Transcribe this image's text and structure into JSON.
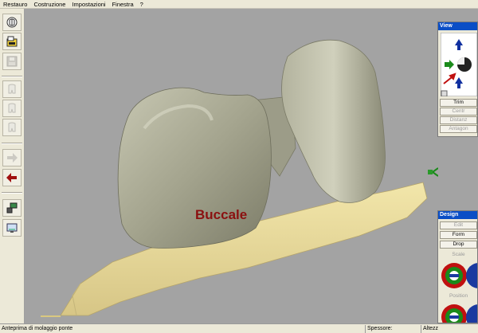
{
  "menu": [
    "Restauro",
    "Costruzione",
    "Impostazioni",
    "Finestra",
    "?"
  ],
  "toolbar": {
    "buttons": [
      {
        "name": "teeth-icon",
        "enabled": true
      },
      {
        "name": "open-folder-icon",
        "enabled": true
      },
      {
        "name": "save-icon",
        "enabled": false
      },
      {
        "name": "tooth-view-1-icon",
        "enabled": false
      },
      {
        "name": "tooth-view-2-icon",
        "enabled": false
      },
      {
        "name": "tooth-view-3-icon",
        "enabled": false
      },
      {
        "name": "arrow-right-icon",
        "enabled": false
      },
      {
        "name": "arrow-left-icon",
        "enabled": true
      },
      {
        "name": "scanner-icon",
        "enabled": true
      },
      {
        "name": "screen-icon",
        "enabled": true
      }
    ]
  },
  "viewport": {
    "label": "Buccale",
    "label_color": "#8b1010",
    "crown_color": "#a7a790",
    "base_color": "#e8db9e"
  },
  "view_panel": {
    "title": "View",
    "buttons": [
      "Trim",
      "Centr",
      "Distanz",
      "Antagon"
    ]
  },
  "design_panel": {
    "title": "Design",
    "buttons": [
      "Edit",
      "Form",
      "Drop"
    ],
    "scale_label": "Scale",
    "position_label": "Position"
  },
  "status": {
    "left": "Anteprima di molaggio ponte",
    "mid": "Spessore:",
    "right": "Altezz"
  },
  "colors": {
    "titlebar": "#0a4ec6",
    "viewport_bg": "#a3a3a3"
  }
}
